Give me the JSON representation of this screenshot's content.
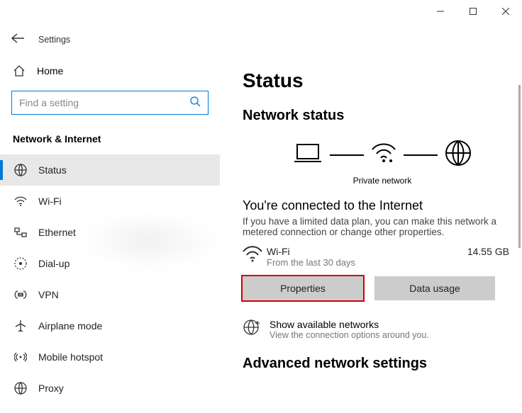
{
  "app_title": "Settings",
  "home_label": "Home",
  "search_placeholder": "Find a setting",
  "section_title": "Network & Internet",
  "nav": {
    "status": "Status",
    "wifi": "Wi-Fi",
    "ethernet": "Ethernet",
    "dialup": "Dial-up",
    "vpn": "VPN",
    "airplane": "Airplane mode",
    "hotspot": "Mobile hotspot",
    "proxy": "Proxy"
  },
  "content": {
    "heading": "Status",
    "subheading": "Network status",
    "private_network": "Private network",
    "connected_title": "You're connected to the Internet",
    "connected_desc": "If you have a limited data plan, you can make this network a metered connection or change other properties.",
    "wifi_name": "Wi-Fi",
    "wifi_period": "From the last 30 days",
    "wifi_data": "14.55 GB",
    "btn_properties": "Properties",
    "btn_data_usage": "Data usage",
    "avail_title": "Show available networks",
    "avail_sub": "View the connection options around you.",
    "advanced_title": "Advanced network settings"
  }
}
